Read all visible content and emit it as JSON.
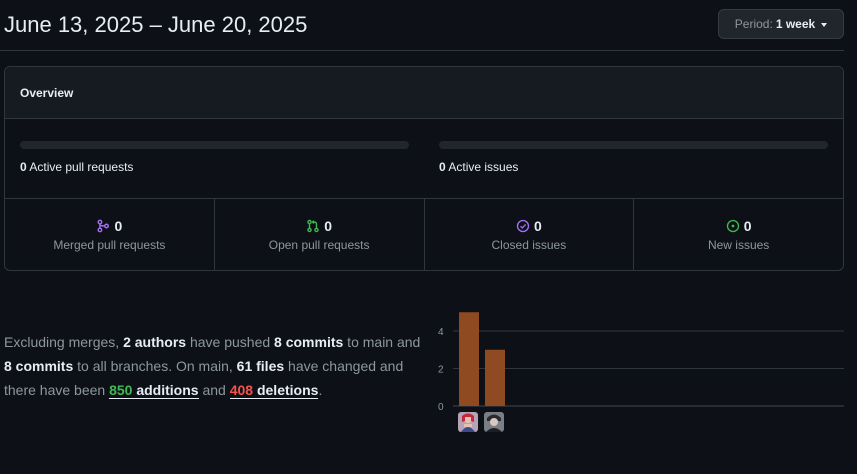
{
  "header": {
    "date_range": "June 13, 2025 – June 20, 2025",
    "period_label": "Period:",
    "period_value": "1 week"
  },
  "overview": {
    "title": "Overview",
    "active_prs": {
      "count": "0",
      "label": "Active pull requests",
      "fraction": 0
    },
    "active_issues": {
      "count": "0",
      "label": "Active issues",
      "fraction": 0
    },
    "stats": [
      {
        "count": "0",
        "label": "Merged pull requests",
        "icon": "merge-icon",
        "color": "#a371f7"
      },
      {
        "count": "0",
        "label": "Open pull requests",
        "icon": "pull-request-icon",
        "color": "#3fb950"
      },
      {
        "count": "0",
        "label": "Closed issues",
        "icon": "issue-closed-icon",
        "color": "#a371f7"
      },
      {
        "count": "0",
        "label": "New issues",
        "icon": "issue-opened-icon",
        "color": "#3fb950"
      }
    ]
  },
  "summary": {
    "t1": "Excluding merges, ",
    "authors": "2 authors",
    "t2": " have pushed ",
    "commits_main": "8 commits",
    "t3": " to main and ",
    "commits_all": "8 commits",
    "t4": " to all branches. On main, ",
    "files": "61 files",
    "t5": " have changed and there have been ",
    "additions_num": "850",
    "additions_word": " additions",
    "t6": " and ",
    "deletions_num": "408",
    "deletions_word": " deletions",
    "t7": "."
  },
  "chart_data": {
    "type": "bar",
    "categories": [
      "author-1",
      "author-2"
    ],
    "values": [
      5,
      3
    ],
    "yticks": [
      "0",
      "2",
      "4"
    ],
    "ylim": [
      0,
      5
    ],
    "bar_color": "#8f4a22",
    "grid_color": "#30363d",
    "grid": true
  }
}
